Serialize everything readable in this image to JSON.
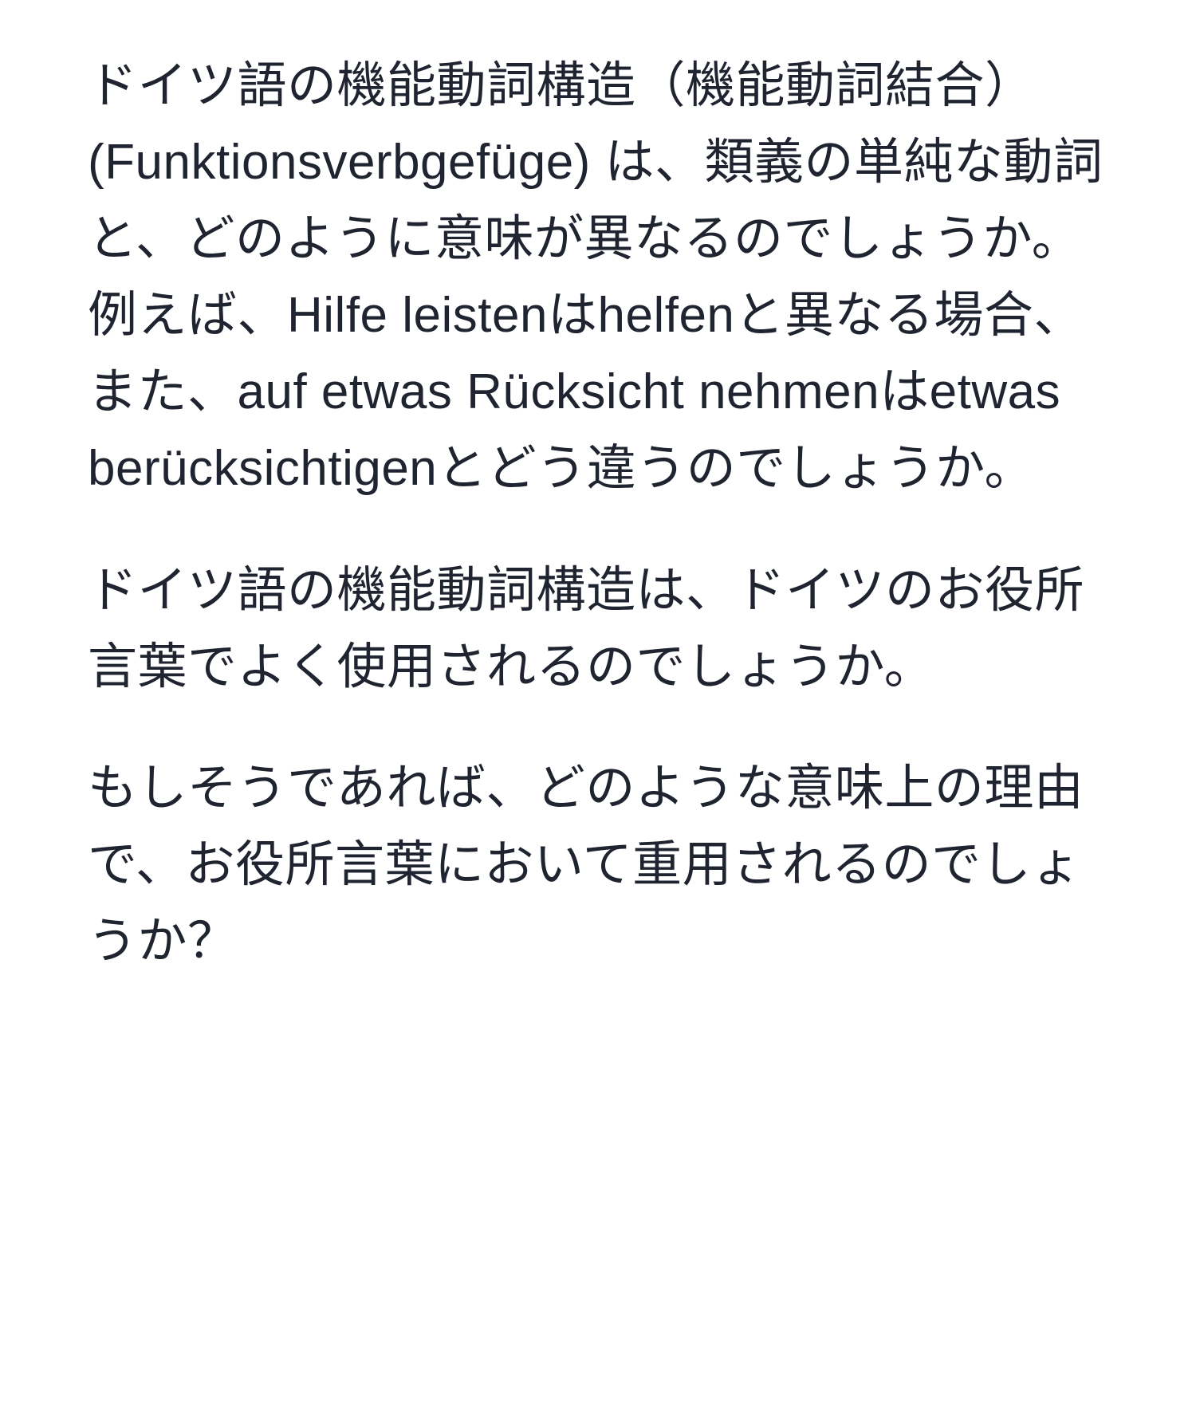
{
  "paragraphs": [
    "ドイツ語の機能動詞構造（機能動詞結合）(Funktionsverbgefüge) は、類義の単純な動詞と、どのように意味が異なるのでしょうか。例えば、Hilfe leistenはhelfenと異なる場合、また、auf etwas Rücksicht nehmenはetwas berücksichtigenとどう違うのでしょうか。",
    "ドイツ語の機能動詞構造は、ドイツのお役所言葉でよく使用されるのでしょうか。",
    "もしそうであれば、どのような意味上の理由で、お役所言葉において重用されるのでしょうか？"
  ]
}
